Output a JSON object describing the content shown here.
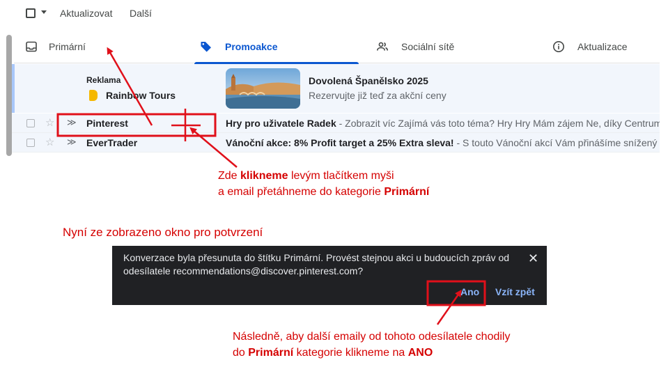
{
  "toolbar": {
    "refresh_label": "Aktualizovat",
    "more_label": "Další"
  },
  "tabs": [
    {
      "label": "Primární",
      "icon": "inbox-icon",
      "active": false
    },
    {
      "label": "Promoakce",
      "icon": "tag-icon",
      "active": true
    },
    {
      "label": "Sociální sítě",
      "icon": "people-icon",
      "active": false
    },
    {
      "label": "Aktualizace",
      "icon": "info-icon",
      "active": false
    }
  ],
  "ad": {
    "label": "Reklama",
    "sender": "Rainbow Tours",
    "title": "Dovolená Španělsko 2025",
    "subtitle": "Rezervujte již teď za akční ceny"
  },
  "emails": [
    {
      "sender": "Pinterest",
      "subject": "Hry pro uživatele Radek",
      "snippet": " - Zobrazit víc Zajímá vás toto téma? Hry Hry Mám zájem Ne, díky Centrum"
    },
    {
      "sender": "EverTrader",
      "subject": "Vánoční akce: 8% Profit target a 25% Extra sleva!",
      "snippet": " - S touto Vánoční akcí Vám přinášíme snížený"
    }
  ],
  "annotations": {
    "drag": {
      "l1_a": "Zde ",
      "l1_b": "klikneme",
      "l1_c": " levým tlačítkem myši",
      "l2_a": "a email přetáhneme do kategorie ",
      "l2_b": "Primární"
    },
    "confirm_heading": "Nyní ze zobrazeno okno pro potvrzení",
    "ano": {
      "l1": "Následně, aby další emaily od tohoto odesílatele chodily",
      "l2_a": "do ",
      "l2_b": "Primární",
      "l2_c": " kategorie klikneme na ",
      "l2_d": "ANO"
    }
  },
  "snackbar": {
    "message": "Konverzace byla přesunuta do štítku Primární. Provést stejnou akci u budoucích zpráv od odesílatele recommendations@discover.pinterest.com?",
    "confirm_label": "Ano",
    "undo_label": "Vzít zpět",
    "close_icon": "close-icon"
  },
  "colors": {
    "accent": "#0b57d0",
    "annotation": "#d50000",
    "snackbar_bg": "#202124",
    "snackbar_action": "#8ab4f8"
  }
}
